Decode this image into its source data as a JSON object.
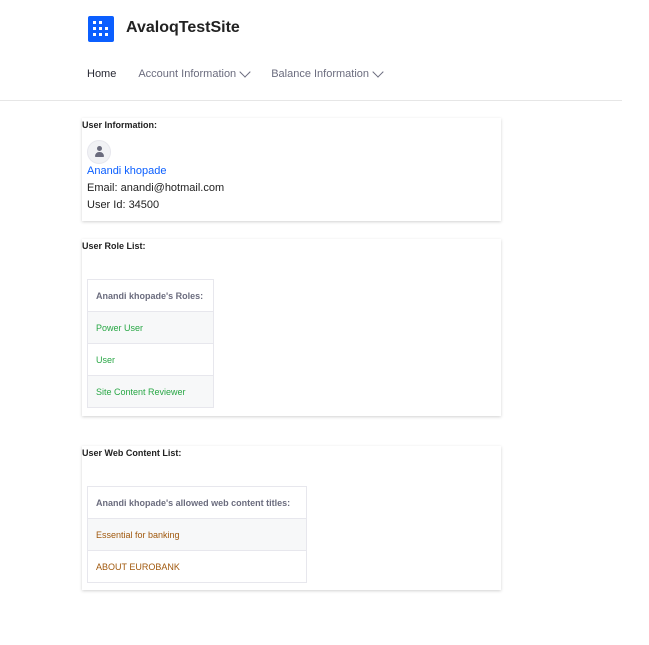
{
  "site": {
    "name": "AvaloqTestSite"
  },
  "nav": {
    "home": "Home",
    "account": "Account Information",
    "balance": "Balance Information"
  },
  "user_info": {
    "title": "User Information:",
    "name": "Anandi khopade",
    "email": "Email: anandi@hotmail.com",
    "user_id": "User Id: 34500"
  },
  "role_list": {
    "title": "User Role List:",
    "header": "Anandi khopade's Roles:",
    "roles": [
      "Power User",
      "User",
      "Site Content Reviewer"
    ]
  },
  "web_content": {
    "title": "User Web Content List:",
    "header": "Anandi khopade's allowed web content titles:",
    "items": [
      "Essential for banking",
      "ABOUT EUROBANK"
    ]
  },
  "colors": {
    "accent": "#0b5fff",
    "role_text": "#28a745",
    "content_text": "#a0580d"
  }
}
